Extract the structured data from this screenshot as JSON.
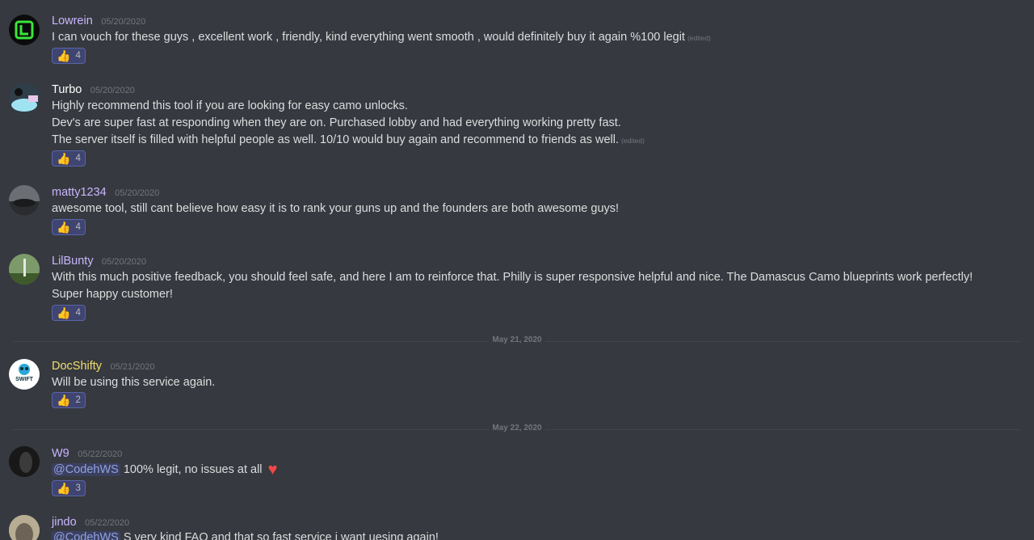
{
  "colors": {
    "background": "#36393f",
    "username_default": "#c9b6ff",
    "username_white": "#ffffff",
    "username_yellow": "#f2de6e",
    "mention": "#8ea1e1",
    "reaction_bg": "#3f4470"
  },
  "messages": [
    {
      "username": "Lowrein",
      "timestamp": "05/20/2020",
      "lines": [
        "I can vouch for these guys , excellent work , friendly, kind everything went smooth , would definitely buy it again %100 legit"
      ],
      "edited": "(edited)",
      "reaction": {
        "emoji": "thumbs-up",
        "count": "4"
      }
    },
    {
      "username": "Turbo",
      "timestamp": "05/20/2020",
      "lines": [
        "Highly recommend this tool if you are looking for easy camo unlocks.",
        "Dev's are super fast at responding when they are on. Purchased lobby and had everything working pretty fast.",
        "The server itself is filled with helpful people as well. 10/10 would buy again and recommend to friends as well."
      ],
      "edited": "(edited)",
      "reaction": {
        "emoji": "thumbs-up",
        "count": "4"
      }
    },
    {
      "username": "matty1234",
      "timestamp": "05/20/2020",
      "lines": [
        "awesome tool, still cant believe how easy it is to rank your guns up and the founders  are both awesome guys!"
      ],
      "reaction": {
        "emoji": "thumbs-up",
        "count": "4"
      }
    },
    {
      "username": "LilBunty",
      "timestamp": "05/20/2020",
      "lines": [
        "With this much positive feedback, you should feel safe, and here I am to reinforce that. Philly is super responsive helpful and nice. The Damascus Camo blueprints work perfectly! Super happy customer!"
      ],
      "reaction": {
        "emoji": "thumbs-up",
        "count": "4"
      }
    },
    {
      "username": "DocShifty",
      "timestamp": "05/21/2020",
      "lines": [
        "Will be using this service again."
      ],
      "reaction": {
        "emoji": "thumbs-up",
        "count": "2"
      },
      "avatar_text": "SWIFT"
    },
    {
      "username": "W9",
      "timestamp": "05/22/2020",
      "mention": "@CodehWS",
      "lines": [
        "100% legit, no issues at all"
      ],
      "reaction": {
        "emoji": "thumbs-up",
        "count": "3"
      }
    },
    {
      "username": "jindo",
      "timestamp": "05/22/2020",
      "mention": "@CodehWS",
      "lines": [
        "S very kind FAQ and that so fast service i want uesing again!"
      ]
    }
  ],
  "dividers": [
    {
      "label": "May 21, 2020"
    },
    {
      "label": "May 22, 2020"
    }
  ]
}
